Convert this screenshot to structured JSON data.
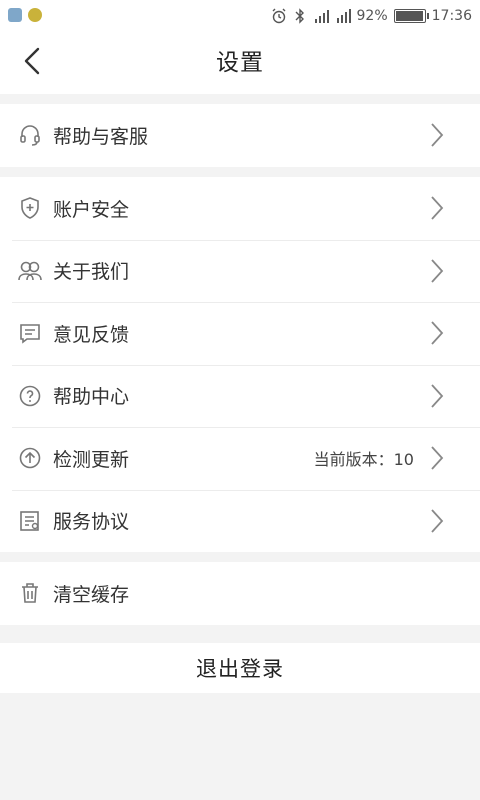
{
  "status_bar": {
    "battery_text": "92%",
    "battery_level": 0.92,
    "time": "17:36"
  },
  "header": {
    "title": "设置"
  },
  "groups": [
    {
      "items": [
        {
          "label": "帮助与客服",
          "icon": "headset-icon"
        }
      ]
    },
    {
      "items": [
        {
          "label": "账户安全",
          "icon": "shield-plus-icon"
        },
        {
          "label": "关于我们",
          "icon": "users-icon"
        },
        {
          "label": "意见反馈",
          "icon": "message-icon"
        },
        {
          "label": "帮助中心",
          "icon": "question-circle-icon"
        },
        {
          "label": "检测更新",
          "icon": "arrow-up-circle-icon",
          "value": "当前版本：10"
        },
        {
          "label": "服务协议",
          "icon": "document-icon"
        }
      ]
    },
    {
      "items": [
        {
          "label": "清空缓存",
          "icon": "trash-icon"
        }
      ]
    }
  ],
  "logout_label": "退出登录",
  "colors": {
    "background": "#f3f3f3",
    "surface": "#ffffff",
    "text": "#333333",
    "icon": "#777777"
  }
}
